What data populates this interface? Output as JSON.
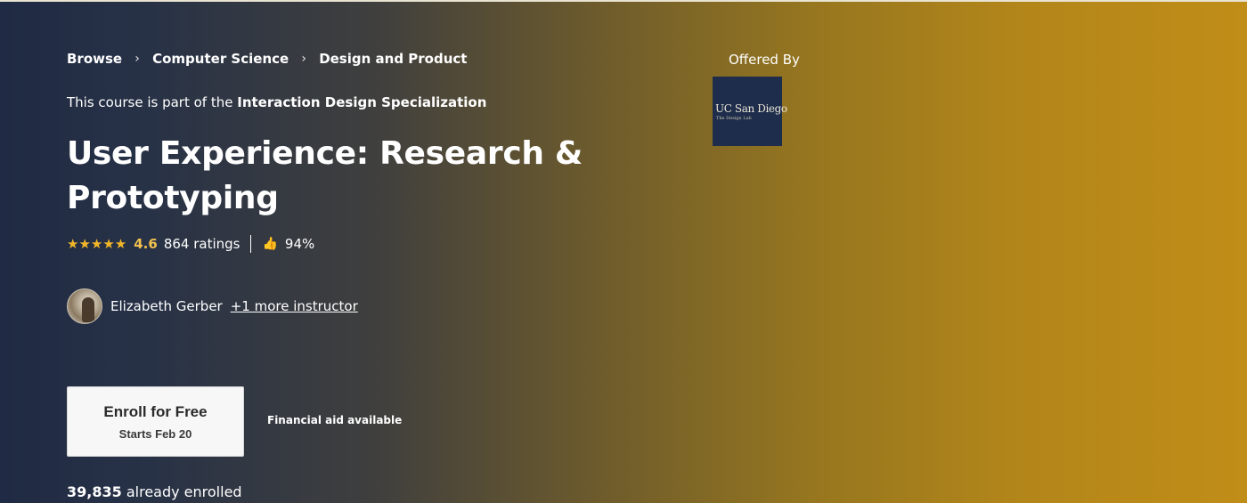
{
  "breadcrumb": {
    "items": [
      "Browse",
      "Computer Science",
      "Design and Product"
    ],
    "separator": "›"
  },
  "course": {
    "part_of_prefix": "This course is part of the",
    "specialization": "Interaction Design Specialization",
    "title": "User Experience: Research & Prototyping"
  },
  "rating": {
    "stars_icon": "star-icons",
    "stars": "★★★★★",
    "value": "4.6",
    "count": "864 ratings",
    "thumb_icon": "thumbs-up-icon",
    "thumb": "👍",
    "approval": "94%"
  },
  "instructor": {
    "name": "Elizabeth Gerber",
    "more_link": "+1 more instructor"
  },
  "enroll": {
    "label": "Enroll for Free",
    "start": "Starts Feb 20"
  },
  "financial_aid": "Financial aid available",
  "enrolled": {
    "count": "39,835",
    "suffix": "already enrolled"
  },
  "offered_by": {
    "label": "Offered By",
    "logo_main": "UC San Diego",
    "logo_sub": "The Design Lab"
  },
  "colors": {
    "gradient_start": "#1f2a44",
    "gradient_end": "#c08d18",
    "star": "#f2b728",
    "logo_bg": "#1e2d4b"
  }
}
